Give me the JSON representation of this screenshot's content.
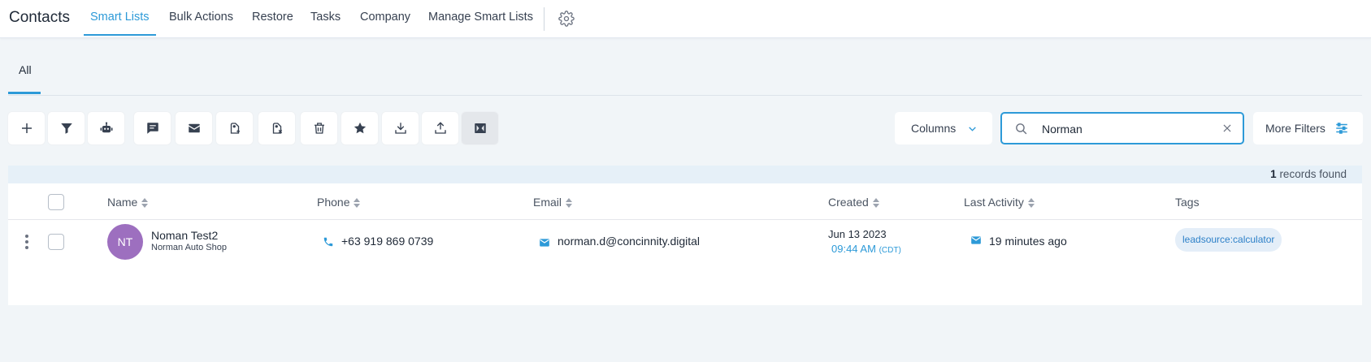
{
  "app": {
    "title": "Contacts"
  },
  "nav": {
    "items": [
      {
        "label": "Smart Lists",
        "active": true
      },
      {
        "label": "Bulk Actions"
      },
      {
        "label": "Restore"
      },
      {
        "label": "Tasks"
      },
      {
        "label": "Company"
      },
      {
        "label": "Manage Smart Lists"
      }
    ]
  },
  "subtabs": {
    "all": "All"
  },
  "toolbar": {
    "columns_label": "Columns",
    "search_value": "Norman",
    "more_filters_label": "More Filters"
  },
  "records": {
    "count": "1",
    "suffix": "records found"
  },
  "table": {
    "headers": {
      "name": "Name",
      "phone": "Phone",
      "email": "Email",
      "created": "Created",
      "last_activity": "Last Activity",
      "tags": "Tags"
    },
    "rows": [
      {
        "initials": "NT",
        "name": "Noman Test2",
        "company": "Norman Auto Shop",
        "phone": "+63 919 869 0739",
        "email": "norman.d@concinnity.digital",
        "created_date": "Jun 13 2023",
        "created_time": "09:44 AM",
        "created_tz": "(CDT)",
        "last_activity": "19 minutes ago",
        "tag": "leadsource:calculator"
      }
    ]
  },
  "colors": {
    "accent": "#2d9ad8",
    "avatar": "#9d6fbf",
    "background": "#f1f5f8"
  }
}
